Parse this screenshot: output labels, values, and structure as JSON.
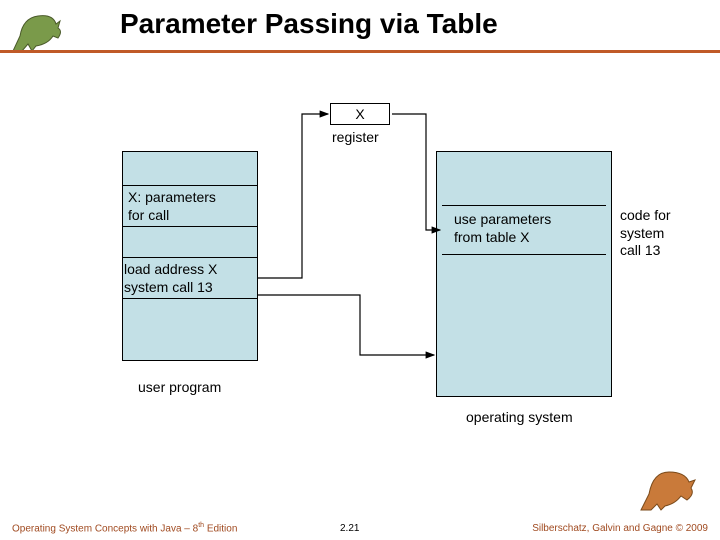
{
  "header": {
    "title": "Parameter Passing via Table"
  },
  "diagram": {
    "x_label": "X",
    "register_label": "register",
    "params_for_call": "X: parameters\nfor call",
    "load_address": "load address X\nsystem call 13",
    "use_params": "use parameters\nfrom table X",
    "code_for_syscall": "code for\nsystem\ncall 13",
    "user_program_label": "user program",
    "os_label": "operating system"
  },
  "footer": {
    "left_prefix": "Operating System Concepts with Java – 8",
    "left_sup": "th",
    "left_suffix": " Edition",
    "center": "2.21",
    "right": "Silberschatz, Galvin and Gagne © 2009"
  },
  "icons": {
    "dino_top": "dinosaur-icon",
    "dino_bottom": "dinosaur-icon"
  },
  "colors": {
    "accent": "#c05a28",
    "box_fill": "#c3e0e6"
  }
}
